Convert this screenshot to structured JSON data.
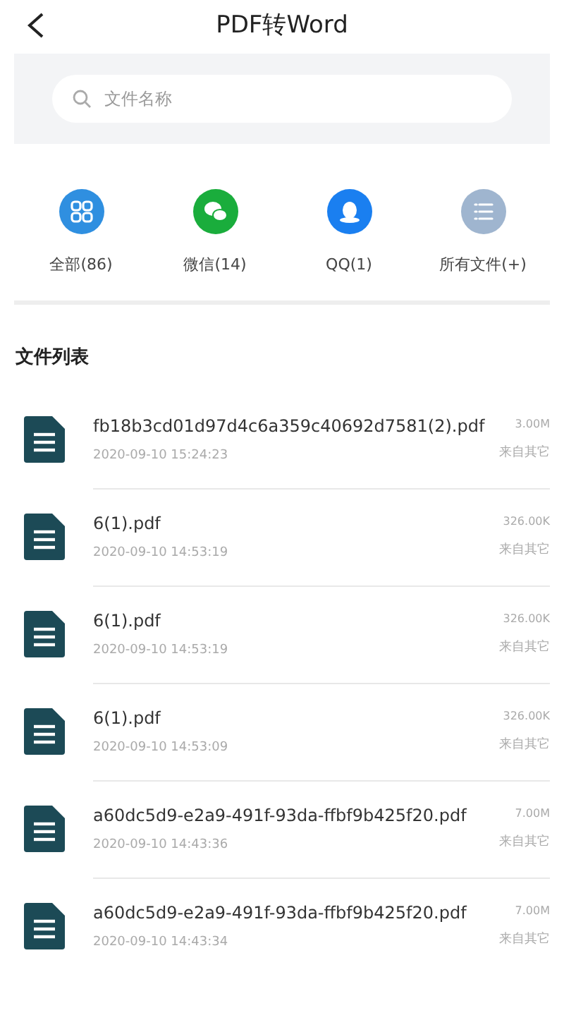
{
  "header": {
    "title": "PDF转Word"
  },
  "search": {
    "placeholder": "文件名称"
  },
  "categories": [
    {
      "kind": "all",
      "label": "全部(86)",
      "color": "#2f8fe0"
    },
    {
      "kind": "wechat",
      "label": "微信(14)",
      "color": "#1aad3c"
    },
    {
      "kind": "qq",
      "label": "QQ(1)",
      "color": "#1a7ff0"
    },
    {
      "kind": "files",
      "label": "所有文件(+)",
      "color": "#9fb5cf"
    }
  ],
  "list_title": "文件列表",
  "files": [
    {
      "name": "fb18b3cd01d97d4c6a359c40692d7581(2).pdf",
      "time": "2020-09-10 15:24:23",
      "size": "3.00M",
      "source": "来自其它"
    },
    {
      "name": "6(1).pdf",
      "time": "2020-09-10 14:53:19",
      "size": "326.00K",
      "source": "来自其它"
    },
    {
      "name": "6(1).pdf",
      "time": "2020-09-10 14:53:19",
      "size": "326.00K",
      "source": "来自其它"
    },
    {
      "name": "6(1).pdf",
      "time": "2020-09-10 14:53:09",
      "size": "326.00K",
      "source": "来自其它"
    },
    {
      "name": "a60dc5d9-e2a9-491f-93da-ffbf9b425f20.pdf",
      "time": "2020-09-10 14:43:36",
      "size": "7.00M",
      "source": "来自其它"
    },
    {
      "name": "a60dc5d9-e2a9-491f-93da-ffbf9b425f20.pdf",
      "time": "2020-09-10 14:43:34",
      "size": "7.00M",
      "source": "来自其它"
    }
  ]
}
